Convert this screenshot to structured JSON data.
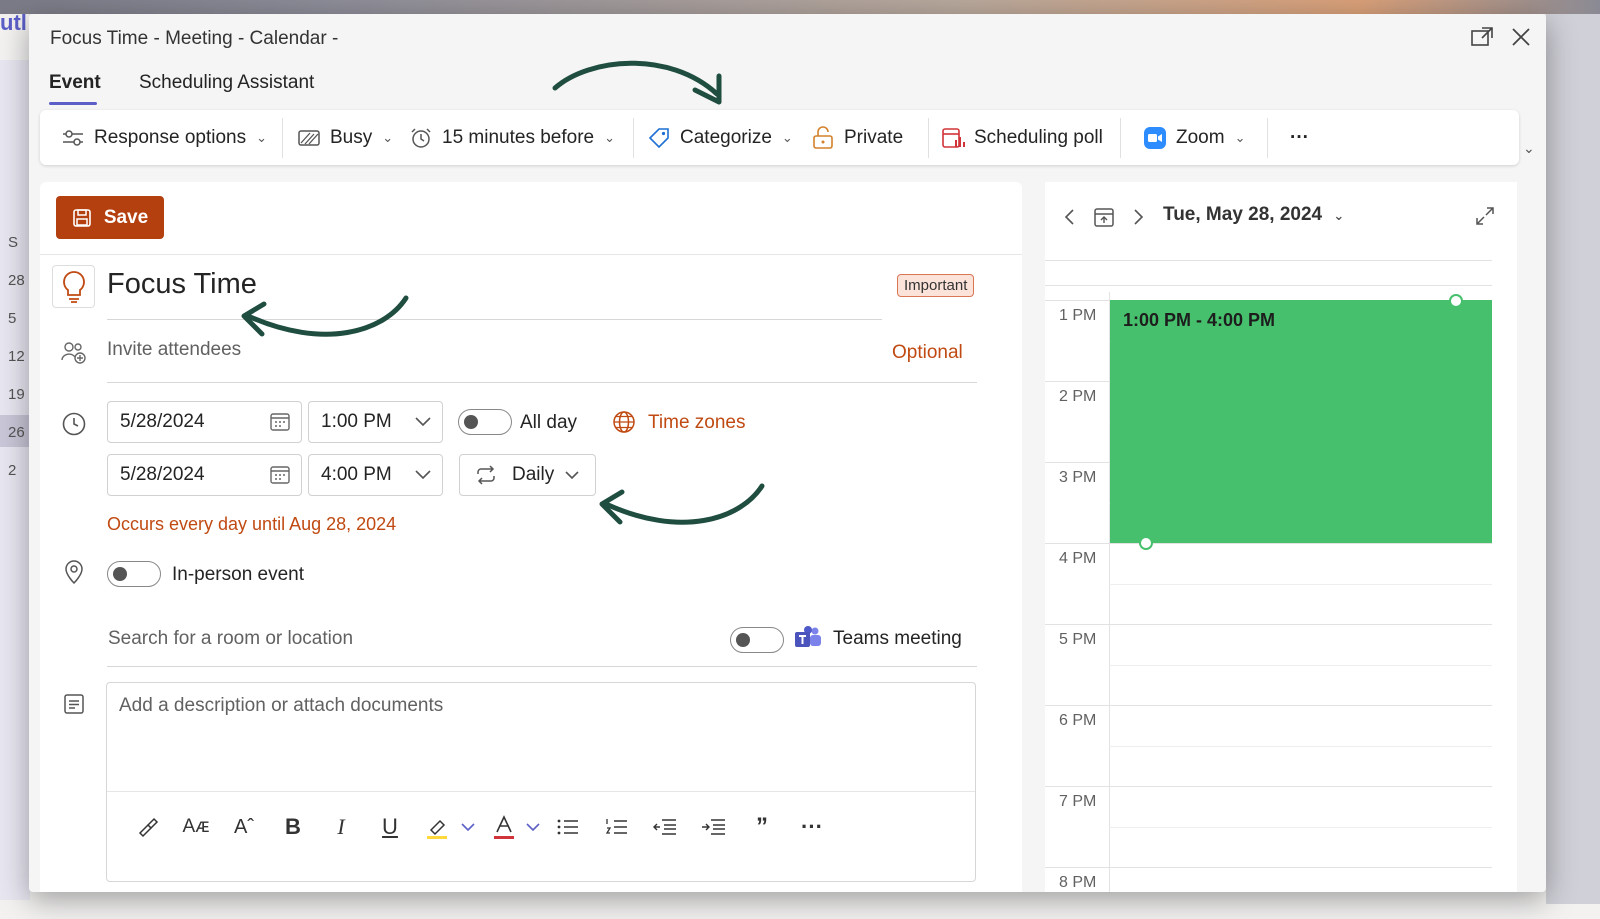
{
  "window": {
    "title": "Focus Time - Meeting - Calendar -",
    "popout_icon": "popout-icon",
    "close_icon": "close-icon"
  },
  "tabs": [
    {
      "label": "Event",
      "active": true
    },
    {
      "label": "Scheduling Assistant",
      "active": false
    }
  ],
  "ribbon": {
    "response_options": "Response options",
    "busy": "Busy",
    "reminder": "15 minutes before",
    "categorize": "Categorize",
    "private": "Private",
    "scheduling_poll": "Scheduling poll",
    "zoom": "Zoom",
    "more": "···"
  },
  "form": {
    "save_label": "Save",
    "title": "Focus Time",
    "category_badge": "Important",
    "invite_placeholder": "Invite attendees",
    "optional_label": "Optional",
    "start_date": "5/28/2024",
    "start_time": "1:00 PM",
    "end_date": "5/28/2024",
    "end_time": "4:00 PM",
    "all_day_label": "All day",
    "time_zones_label": "Time zones",
    "recurrence_label": "Daily",
    "recurrence_summary": "Occurs every day until Aug 28, 2024",
    "in_person_label": "In-person event",
    "location_placeholder": "Search for a room or location",
    "teams_label": "Teams meeting",
    "description_placeholder": "Add a description or attach documents",
    "all_day_on": false,
    "in_person_on": false,
    "teams_on": false
  },
  "calendar_pane": {
    "date_label": "Tue, May 28, 2024",
    "hours": [
      "1 PM",
      "2 PM",
      "3 PM",
      "4 PM",
      "5 PM",
      "6 PM",
      "7 PM",
      "8 PM"
    ],
    "event_time": "1:00 PM - 4:00 PM",
    "event_color": "#46c06c"
  },
  "background": {
    "brand_fragment": "utl",
    "day_numbers": [
      "S",
      "28",
      "5",
      "12",
      "19",
      "26",
      "2"
    ]
  },
  "colors": {
    "save_button": "#b5400f",
    "accent": "#5b5fc7",
    "orange_text": "#c04a12",
    "event_green": "#46c06c"
  }
}
